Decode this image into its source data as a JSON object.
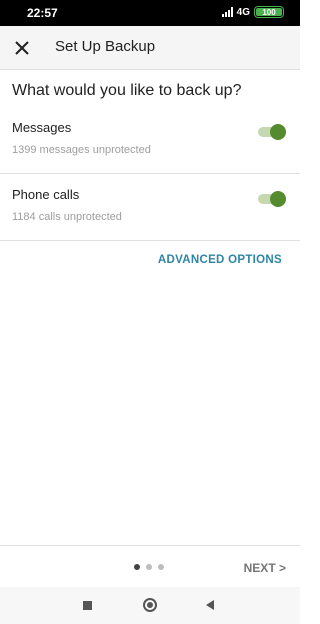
{
  "status_bar": {
    "time": "22:57",
    "network": "4G",
    "battery": "100"
  },
  "header": {
    "title": "Set Up Backup"
  },
  "main": {
    "question": "What would you like to back up?",
    "options": [
      {
        "title": "Messages",
        "subtitle": "1399 messages unprotected",
        "enabled": true
      },
      {
        "title": "Phone calls",
        "subtitle": "1184 calls unprotected",
        "enabled": true
      }
    ],
    "advanced_label": "ADVANCED OPTIONS"
  },
  "footer": {
    "pages": 3,
    "current_page": 1,
    "next_label": "NEXT >"
  },
  "colors": {
    "accent": "#2e86a6",
    "toggle_on": "#558b2f",
    "toggle_track": "#c5d8b0"
  }
}
